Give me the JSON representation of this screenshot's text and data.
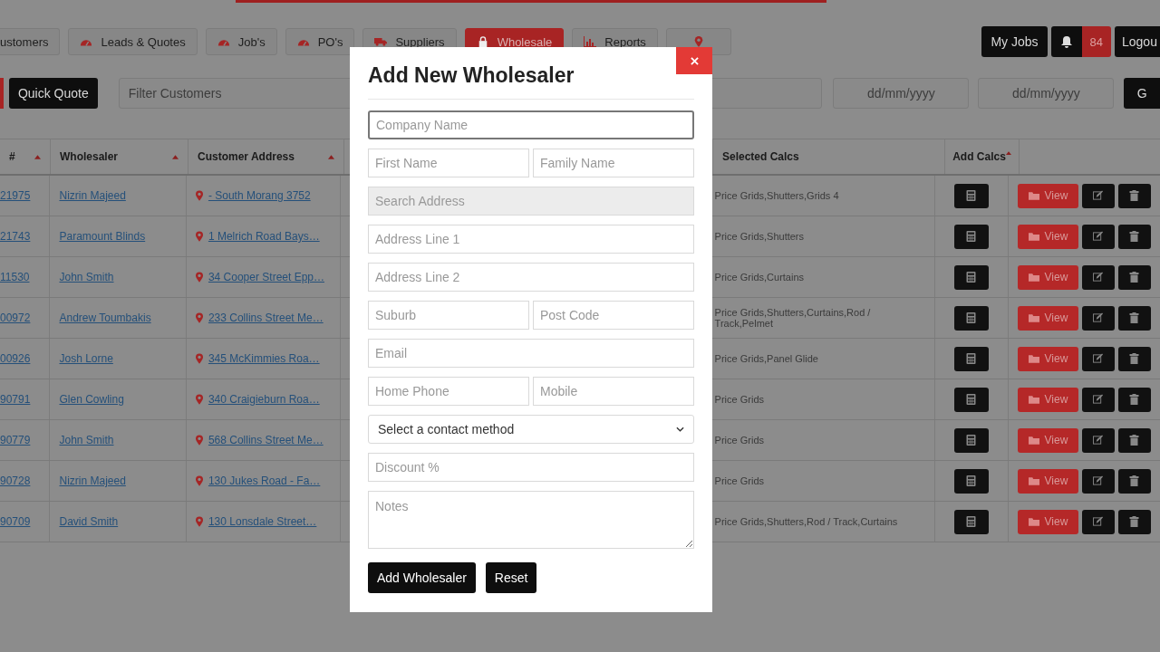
{
  "nav": {
    "tabs": [
      {
        "label": "ustomers",
        "selected": false
      },
      {
        "label": "Leads & Quotes",
        "selected": false
      },
      {
        "label": "Job's",
        "selected": false
      },
      {
        "label": "PO's",
        "selected": false
      },
      {
        "label": "Suppliers",
        "selected": false
      },
      {
        "label": "Wholesale",
        "selected": true
      },
      {
        "label": "Reports",
        "selected": false
      },
      {
        "selected": false
      }
    ],
    "my_jobs": "My Jobs",
    "notification_count": "84",
    "logout": "Logou"
  },
  "toolbar": {
    "quick_quote": "Quick Quote",
    "filter": {
      "placeholder": "Filter Customers"
    },
    "date_from": {
      "placeholder": "dd/mm/yyyy"
    },
    "date_to": {
      "placeholder": "dd/mm/yyyy"
    },
    "go": "G"
  },
  "table": {
    "columns": [
      "#",
      "Wholesaler",
      "Customer Address",
      "Selected Calcs",
      "Add Calcs"
    ],
    "rows": [
      {
        "number": "21975",
        "wholesaler": "Nizrin Majeed",
        "address": "- South Morang 3752",
        "calcs": "Price Grids,Shutters,Grids 4",
        "view": "View"
      },
      {
        "number": "21743",
        "wholesaler": "Paramount Blinds",
        "address": "1 Melrich Road Bays…",
        "calcs": "Price Grids,Shutters",
        "view": "View"
      },
      {
        "number": "11530",
        "wholesaler": "John Smith",
        "address": "34 Cooper Street Epp…",
        "calcs": "Price Grids,Curtains",
        "view": "View"
      },
      {
        "number": "00972",
        "wholesaler": "Andrew Toumbakis",
        "address": "233 Collins Street Me…",
        "calcs": "Price Grids,Shutters,Curtains,Rod / Track,Pelmet",
        "view": "View"
      },
      {
        "number": "00926",
        "wholesaler": "Josh Lorne",
        "address": "345 McKimmies Roa…",
        "calcs": "Price Grids,Panel Glide",
        "view": "View"
      },
      {
        "number": "90791",
        "wholesaler": "Glen Cowling",
        "address": "340 Craigieburn Roa…",
        "calcs": "Price Grids",
        "view": "View"
      },
      {
        "number": "90779",
        "wholesaler": "John Smith",
        "address": "568 Collins Street Me…",
        "calcs": "Price Grids",
        "view": "View"
      },
      {
        "number": "90728",
        "wholesaler": "Nizrin Majeed",
        "address": "130 Jukes Road - Fa…",
        "calcs": "Price Grids",
        "view": "View"
      },
      {
        "number": "90709",
        "wholesaler": "David Smith",
        "address": "130 Lonsdale Street…",
        "calcs": "Price Grids,Shutters,Rod / Track,Curtains",
        "view": "View"
      }
    ]
  },
  "modal": {
    "title": "Add New Wholesaler",
    "rows": [
      [
        {
          "kind": "text",
          "placeholder": "Company Name",
          "focused": true,
          "disabled": false
        }
      ],
      [
        {
          "kind": "text",
          "placeholder": "First Name",
          "focused": false,
          "disabled": false
        },
        {
          "kind": "text",
          "placeholder": "Family Name",
          "focused": false,
          "disabled": false
        }
      ],
      [
        {
          "kind": "text",
          "placeholder": "Search Address",
          "focused": false,
          "disabled": true
        }
      ],
      [
        {
          "kind": "text",
          "placeholder": "Address Line 1",
          "focused": false,
          "disabled": false
        }
      ],
      [
        {
          "kind": "text",
          "placeholder": "Address Line 2",
          "focused": false,
          "disabled": false
        }
      ],
      [
        {
          "kind": "text",
          "placeholder": "Suburb",
          "focused": false,
          "disabled": false
        },
        {
          "kind": "text",
          "placeholder": "Post Code",
          "focused": false,
          "disabled": false
        }
      ],
      [
        {
          "kind": "text",
          "placeholder": "Email",
          "focused": false,
          "disabled": false
        }
      ],
      [
        {
          "kind": "text",
          "placeholder": "Home Phone",
          "focused": false,
          "disabled": false
        },
        {
          "kind": "text",
          "placeholder": "Mobile",
          "focused": false,
          "disabled": false
        }
      ],
      [
        {
          "kind": "select",
          "placeholder": "Select a contact method",
          "focused": false,
          "disabled": false
        }
      ],
      [
        {
          "kind": "text",
          "placeholder": "Discount %",
          "focused": false,
          "disabled": false
        }
      ],
      [
        {
          "kind": "textarea",
          "placeholder": "Notes",
          "focused": false,
          "disabled": false
        }
      ]
    ],
    "buttons": [
      "Add Wholesaler",
      "Reset"
    ]
  }
}
